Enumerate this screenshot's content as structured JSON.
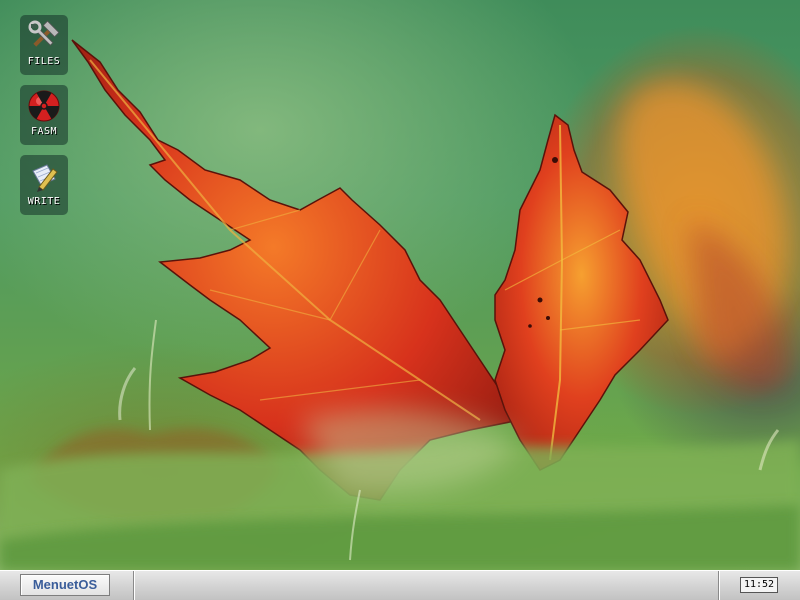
{
  "desktop": {
    "icons": [
      {
        "label": "FILES",
        "icon": "tools-icon"
      },
      {
        "label": "FASM",
        "icon": "radiation-icon"
      },
      {
        "label": "WRITE",
        "icon": "pen-icon"
      }
    ],
    "wallpaper": "red-maple-leaf-in-grass"
  },
  "taskbar": {
    "start_label": "MenuetOS",
    "clock": "11:52"
  },
  "colors": {
    "leaf_red": "#d7321c",
    "leaf_orange": "#f07a22",
    "grass_green": "#6ea84a",
    "taskbar_gray": "#d4d4d4",
    "start_text": "#3a5d9a"
  }
}
